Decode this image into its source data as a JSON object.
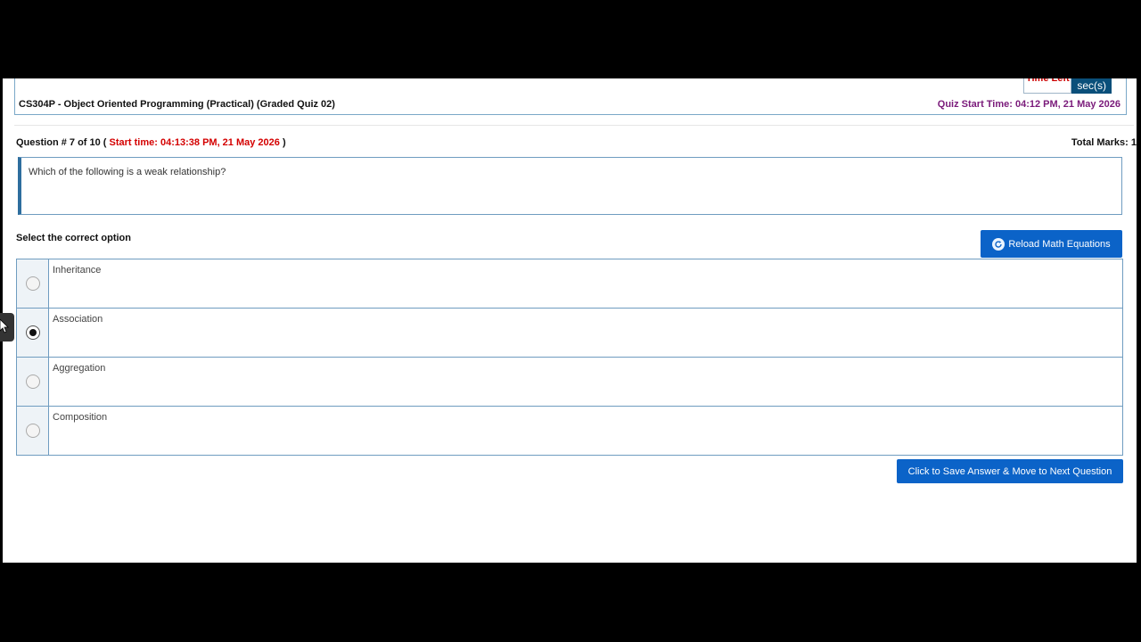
{
  "header": {
    "timer_label": "Time Left",
    "timer_unit": "sec(s)",
    "course_title": "CS304P - Object Oriented Programming (Practical) (Graded Quiz 02)",
    "quiz_start": "Quiz Start Time: 04:12 PM, 21 May 2026"
  },
  "question": {
    "number_text": "Question # 7 of 10 ( ",
    "start_time": "Start time: 04:13:38 PM, 21 May 2026",
    "close_paren": " )",
    "total_marks": "Total Marks: 1",
    "text": "Which of the following is a weak relationship?"
  },
  "select_label": "Select the correct option",
  "reload_button": "Reload Math Equations",
  "options": [
    {
      "label": "Inheritance",
      "selected": false
    },
    {
      "label": "Association",
      "selected": true
    },
    {
      "label": "Aggregation",
      "selected": false
    },
    {
      "label": "Composition",
      "selected": false
    }
  ],
  "save_button": "Click to Save Answer & Move to Next Question"
}
